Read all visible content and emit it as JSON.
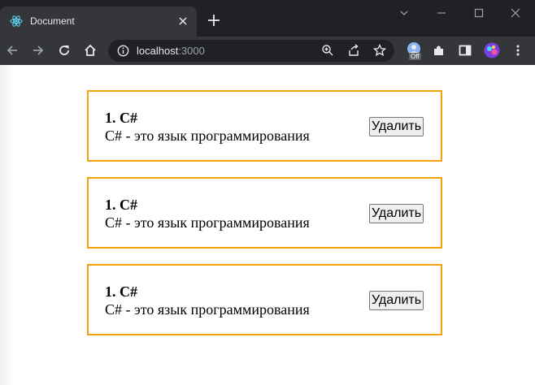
{
  "browser": {
    "tab": {
      "title": "Document",
      "favicon": "react-logo-icon"
    },
    "address_bar": {
      "host": "localhost",
      "port": ":3000"
    },
    "extension_badge": "Off",
    "colors": {
      "tab_bar": "#202124",
      "toolbar": "#35363a",
      "omnibox": "#202124",
      "icon": "#e8eaed"
    }
  },
  "cards": [
    {
      "title": "1. C#",
      "description": "C# - это язык программирования",
      "delete_label": "Удалить"
    },
    {
      "title": "1. C#",
      "description": "C# - это язык программирования",
      "delete_label": "Удалить"
    },
    {
      "title": "1. C#",
      "description": "C# - это язык программирования",
      "delete_label": "Удалить"
    }
  ],
  "colors": {
    "card_border": "#f5a20a",
    "page_background": "#ffffff"
  }
}
